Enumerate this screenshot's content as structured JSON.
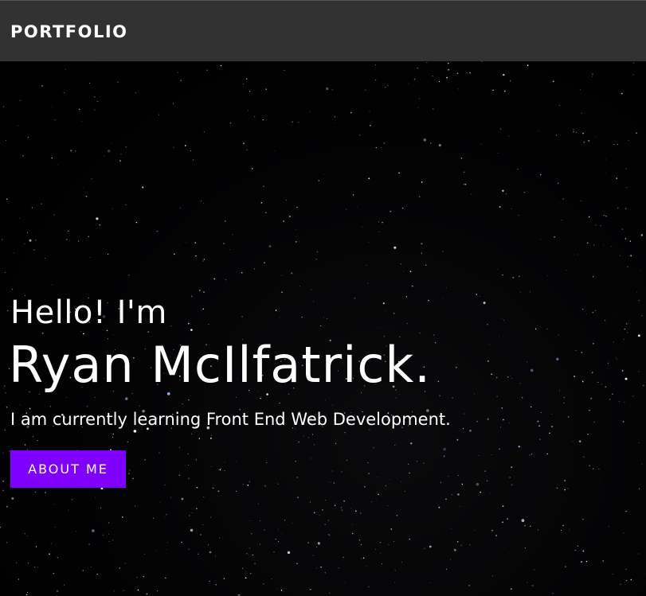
{
  "navbar": {
    "brand": "PORTFOLIO"
  },
  "hero": {
    "greeting": "Hello! I'm",
    "name": "Ryan McIlfatrick.",
    "subtitle": "I am currently learning Front End Web Development.",
    "cta_label": "ABOUT ME"
  },
  "colors": {
    "navbar_bg": "#323232",
    "accent": "#7f00ff",
    "background": "#000000",
    "text": "#ffffff"
  }
}
